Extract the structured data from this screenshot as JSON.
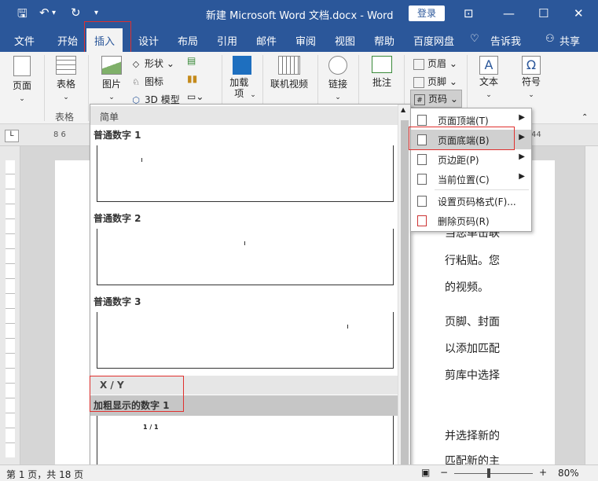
{
  "titlebar": {
    "title": "新建 Microsoft Word 文档.docx  -  Word",
    "login": "登录",
    "save_icon": "save-icon",
    "undo_icon": "undo-icon",
    "redo_icon": "redo-icon"
  },
  "tabs": [
    {
      "label": "文件"
    },
    {
      "label": "开始"
    },
    {
      "label": "插入"
    },
    {
      "label": "设计"
    },
    {
      "label": "布局"
    },
    {
      "label": "引用"
    },
    {
      "label": "邮件"
    },
    {
      "label": "审阅"
    },
    {
      "label": "视图"
    },
    {
      "label": "帮助"
    },
    {
      "label": "百度网盘"
    },
    {
      "label": "告诉我"
    },
    {
      "label": "共享"
    }
  ],
  "ribbon": {
    "pages": "页面",
    "table": "表格",
    "table_group": "表格",
    "picture": "图片",
    "shapes": "形状",
    "icons": "图标",
    "model3d": "3D 模型",
    "addins": "加载项",
    "video": "联机视频",
    "link": "链接",
    "comment": "批注",
    "header": "页眉",
    "footer": "页脚",
    "pagenum": "页码",
    "text": "文本",
    "symbol": "符号"
  },
  "gallery": {
    "section1": "简单",
    "item1": "普通数字 1",
    "item2": "普通数字 2",
    "item3": "普通数字 3",
    "section2": "X / Y",
    "item4": "加粗显示的数字 1",
    "thumb4_text": "1 / 1"
  },
  "menu": {
    "items": [
      {
        "label": "页面顶端(T)"
      },
      {
        "label": "页面底端(B)"
      },
      {
        "label": "页边距(P)"
      },
      {
        "label": "当前位置(C)"
      },
      {
        "label": "设置页码格式(F)..."
      },
      {
        "label": "删除页码(R)"
      }
    ]
  },
  "document": {
    "lines": [
      "当您单击联",
      "行粘贴。您",
      "的视频。",
      "页脚、封面",
      "以添加匹配",
      "剪库中选择",
      "并选择新的",
      "匹配新的主"
    ]
  },
  "ruler": {
    "left_marks": "8  6"
  },
  "status": {
    "pages": "第 1 页，共 18 页",
    "zoom": "80%"
  }
}
